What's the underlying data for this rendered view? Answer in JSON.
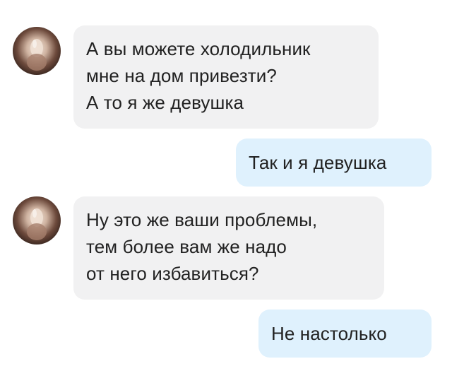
{
  "colors": {
    "incoming_bubble": "#f1f1f2",
    "outgoing_bubble": "#dff1fd",
    "text": "#222222",
    "background": "#ffffff"
  },
  "messages": [
    {
      "direction": "incoming",
      "avatar": "avatar-photo",
      "lines": [
        "А вы можете холодильник",
        "мне на дом привезти?",
        "А то я же девушка"
      ]
    },
    {
      "direction": "outgoing",
      "lines": [
        "Так и я девушка"
      ]
    },
    {
      "direction": "incoming",
      "avatar": "avatar-photo",
      "lines": [
        "Ну это же ваши проблемы,",
        "тем более вам же надо",
        "от него избавиться?"
      ]
    },
    {
      "direction": "outgoing",
      "lines": [
        "Не настолько"
      ]
    }
  ]
}
